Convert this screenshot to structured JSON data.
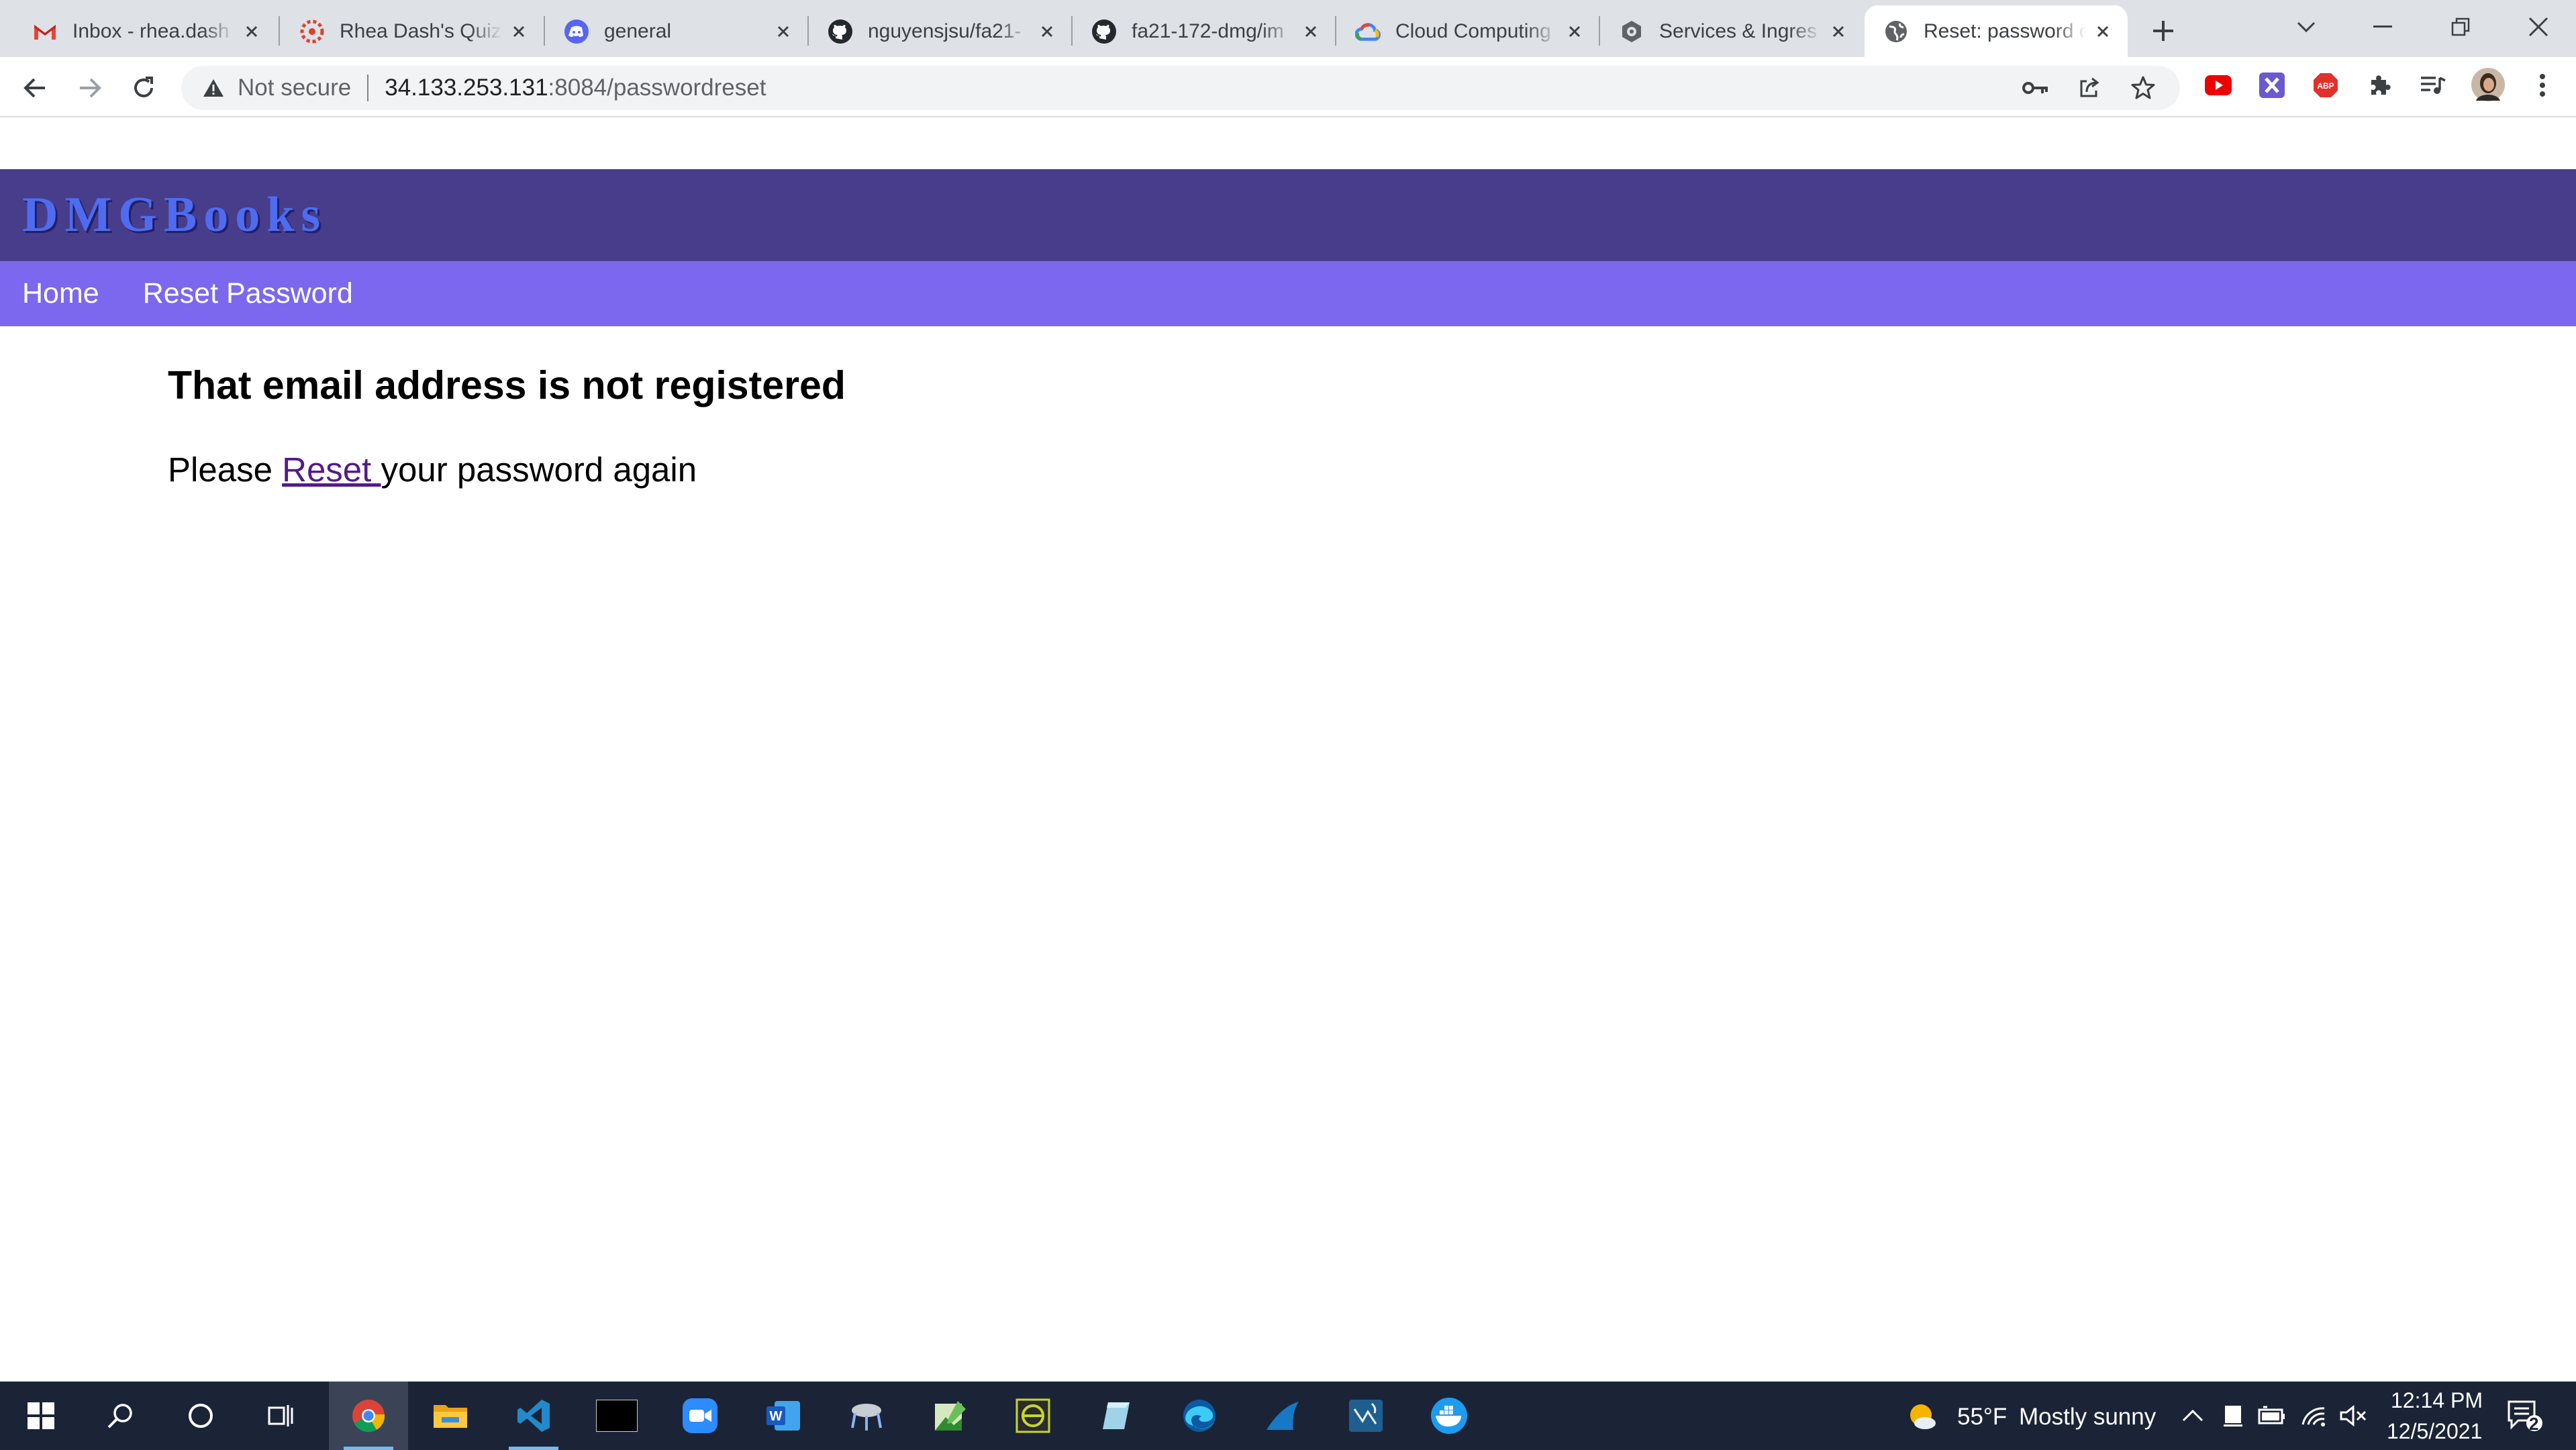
{
  "browser": {
    "tabs": [
      {
        "title": "Inbox - rhea.dash",
        "icon": "gmail-icon",
        "active": false
      },
      {
        "title": "Rhea Dash's Quiz",
        "icon": "canvas-icon",
        "active": false
      },
      {
        "title": "general",
        "icon": "discord-icon",
        "active": false
      },
      {
        "title": "nguyensjsu/fa21-",
        "icon": "github-icon",
        "active": false
      },
      {
        "title": "fa21-172-dmg/im",
        "icon": "github-icon",
        "active": false
      },
      {
        "title": "Cloud Computing",
        "icon": "google-cloud-icon",
        "active": false
      },
      {
        "title": "Services & Ingres",
        "icon": "gcp-services-icon",
        "active": false
      },
      {
        "title": "Reset: password c",
        "icon": "globe-icon",
        "active": true
      }
    ],
    "omnibox": {
      "security_label": "Not secure",
      "url_host": "34.133.253.131",
      "url_rest": ":8084/passwordreset"
    }
  },
  "site": {
    "brand": "DMGBooks",
    "nav": [
      {
        "label": "Home"
      },
      {
        "label": "Reset Password"
      }
    ],
    "message": {
      "heading": "That email address is not registered",
      "prefix": "Please ",
      "link_text": "Reset ",
      "suffix": "your password again"
    }
  },
  "taskbar": {
    "weather": {
      "temp": "55°F",
      "condition": "Mostly sunny"
    },
    "clock": {
      "time": "12:14 PM",
      "date": "12/5/2021"
    },
    "notifications": "2",
    "apps": [
      "start-icon",
      "search-icon",
      "cortana-icon",
      "task-view-icon",
      "chrome-icon",
      "file-explorer-icon",
      "vscode-icon",
      "terminal-icon",
      "zoom-icon",
      "word-icon",
      "ssh-client-icon",
      "image-editor-icon",
      "eclipse-icon",
      "notes-icon",
      "edge-icon",
      "wireshark-icon",
      "mysql-workbench-icon",
      "docker-icon"
    ]
  },
  "colors": {
    "header_bg": "#483d8b",
    "nav_bg": "#7b68ee",
    "brand_text": "#4f6cf0",
    "link": "#551a8b",
    "taskbar_bg": "#1b2436"
  }
}
